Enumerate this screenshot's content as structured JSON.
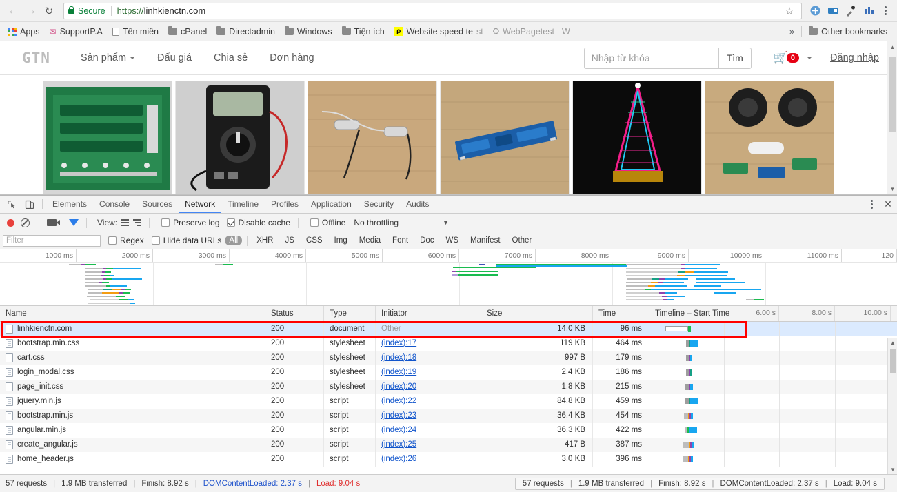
{
  "browser": {
    "back_icon": "back-arrow-icon",
    "forward_icon": "forward-arrow-icon",
    "reload_icon": "reload-icon",
    "security_label": "Secure",
    "url_scheme": "https://",
    "url_rest": "linhkienctn.com",
    "star_glyph": "☆",
    "extensions": [
      "extension-icon-1",
      "extension-icon-2",
      "eyedropper-icon",
      "analytics-icon"
    ],
    "menu_icon": "three-dot-menu-icon"
  },
  "bookmarks": {
    "items": [
      {
        "label": "Apps",
        "icon": "apps-grid-icon"
      },
      {
        "label": "SupportP.A",
        "icon": "support-icon"
      },
      {
        "label": "Tên miền",
        "icon": "document-icon"
      },
      {
        "label": "cPanel",
        "icon": "folder-icon"
      },
      {
        "label": "Directadmin",
        "icon": "folder-icon"
      },
      {
        "label": "Windows",
        "icon": "folder-icon"
      },
      {
        "label": "Tiện ích",
        "icon": "folder-icon"
      },
      {
        "label": "Website speed te",
        "label_faded": "st",
        "icon": "pi-icon"
      },
      {
        "label": "WebPagetest - W",
        "icon": "webpagetest-icon"
      }
    ],
    "overflow_glyph": "»",
    "other_bookmarks": "Other bookmarks"
  },
  "site": {
    "logo": "GTN",
    "nav": [
      {
        "label": "Sản phẩm",
        "has_caret": true
      },
      {
        "label": "Đấu giá",
        "has_caret": false
      },
      {
        "label": "Chia sẻ",
        "has_caret": false
      },
      {
        "label": "Đơn hàng",
        "has_caret": false
      }
    ],
    "search_placeholder": "Nhập từ khóa",
    "search_value": "",
    "search_button": "Tìm",
    "cart_count": "0",
    "login_label": "Đăng nhập",
    "products": [
      {
        "name": "bms-battery-protection-board",
        "bg": "#2f7d4a"
      },
      {
        "name": "digital-multimeter",
        "bg": "#1d1d1d"
      },
      {
        "name": "inductor-coil-on-wood",
        "bg": "#caa87c"
      },
      {
        "name": "blue-pcb-module",
        "bg": "#c0a67e"
      },
      {
        "name": "led-light-tower",
        "bg": "#111111"
      },
      {
        "name": "speakers-and-components",
        "bg": "#c7a97b"
      }
    ]
  },
  "devtools": {
    "tabs": [
      {
        "label": "Elements",
        "active": false
      },
      {
        "label": "Console",
        "active": false
      },
      {
        "label": "Sources",
        "active": false
      },
      {
        "label": "Network",
        "active": true
      },
      {
        "label": "Timeline",
        "active": false
      },
      {
        "label": "Profiles",
        "active": false
      },
      {
        "label": "Application",
        "active": false
      },
      {
        "label": "Security",
        "active": false
      },
      {
        "label": "Audits",
        "active": false
      }
    ],
    "more_icon": "three-dot-menu-icon",
    "close_icon": "close-icon",
    "toolbar": {
      "record_icon": "record-icon",
      "clear_icon": "clear-icon",
      "camera_icon": "camera-icon",
      "filter_icon": "filter-icon",
      "view_label": "View:",
      "preserve_log_label": "Preserve log",
      "preserve_log_checked": false,
      "disable_cache_label": "Disable cache",
      "disable_cache_checked": true,
      "offline_label": "Offline",
      "offline_checked": false,
      "throttling_label": "No throttling",
      "throttling_caret": "▼"
    },
    "filters": {
      "filter_placeholder": "Filter",
      "filter_value": "",
      "regex_label": "Regex",
      "regex_checked": false,
      "hide_data_urls_label": "Hide data URLs",
      "hide_data_urls_checked": false,
      "types": [
        "All",
        "XHR",
        "JS",
        "CSS",
        "Img",
        "Media",
        "Font",
        "Doc",
        "WS",
        "Manifest",
        "Other"
      ],
      "active_type": "All"
    },
    "overview_ticks": [
      "1000 ms",
      "2000 ms",
      "3000 ms",
      "4000 ms",
      "5000 ms",
      "6000 ms",
      "7000 ms",
      "8000 ms",
      "9000 ms",
      "10000 ms",
      "11000 ms",
      "120"
    ],
    "table": {
      "columns": [
        "Name",
        "Status",
        "Type",
        "Initiator",
        "Size",
        "Time",
        "Timeline – Start Time"
      ],
      "waterfall_ticks": [
        "6.00 s",
        "8.00 s",
        "10.00 s"
      ],
      "rows": [
        {
          "name": "linhkienctn.com",
          "status": "200",
          "type": "document",
          "initiator": "Other",
          "initiator_is_link": false,
          "size": "14.0 KB",
          "time": "96 ms",
          "selected": true
        },
        {
          "name": "bootstrap.min.css",
          "status": "200",
          "type": "stylesheet",
          "initiator": "(index):17",
          "initiator_is_link": true,
          "size": "119 KB",
          "time": "464 ms",
          "selected": false
        },
        {
          "name": "cart.css",
          "status": "200",
          "type": "stylesheet",
          "initiator": "(index):18",
          "initiator_is_link": true,
          "size": "997 B",
          "time": "179 ms",
          "selected": false
        },
        {
          "name": "login_modal.css",
          "status": "200",
          "type": "stylesheet",
          "initiator": "(index):19",
          "initiator_is_link": true,
          "size": "2.4 KB",
          "time": "186 ms",
          "selected": false
        },
        {
          "name": "page_init.css",
          "status": "200",
          "type": "stylesheet",
          "initiator": "(index):20",
          "initiator_is_link": true,
          "size": "1.8 KB",
          "time": "215 ms",
          "selected": false
        },
        {
          "name": "jquery.min.js",
          "status": "200",
          "type": "script",
          "initiator": "(index):22",
          "initiator_is_link": true,
          "size": "84.8 KB",
          "time": "459 ms",
          "selected": false
        },
        {
          "name": "bootstrap.min.js",
          "status": "200",
          "type": "script",
          "initiator": "(index):23",
          "initiator_is_link": true,
          "size": "36.4 KB",
          "time": "454 ms",
          "selected": false
        },
        {
          "name": "angular.min.js",
          "status": "200",
          "type": "script",
          "initiator": "(index):24",
          "initiator_is_link": true,
          "size": "36.3 KB",
          "time": "422 ms",
          "selected": false
        },
        {
          "name": "create_angular.js",
          "status": "200",
          "type": "script",
          "initiator": "(index):25",
          "initiator_is_link": true,
          "size": "417 B",
          "time": "387 ms",
          "selected": false
        },
        {
          "name": "home_header.js",
          "status": "200",
          "type": "script",
          "initiator": "(index):26",
          "initiator_is_link": true,
          "size": "3.0 KB",
          "time": "396 ms",
          "selected": false
        }
      ]
    },
    "status": {
      "requests": "57 requests",
      "transferred": "1.9 MB transferred",
      "finish": "Finish: 8.92 s",
      "dom_content_loaded": "DOMContentLoaded: 2.37 s",
      "load": "Load: 9.04 s",
      "separator": "|"
    }
  },
  "colors": {
    "accent": "#4285f4",
    "highlight_red": "#ff0000",
    "secure_green": "#098039",
    "link_blue": "#1155cc",
    "load_red": "#e03030",
    "dcl_blue": "#2255cc"
  }
}
